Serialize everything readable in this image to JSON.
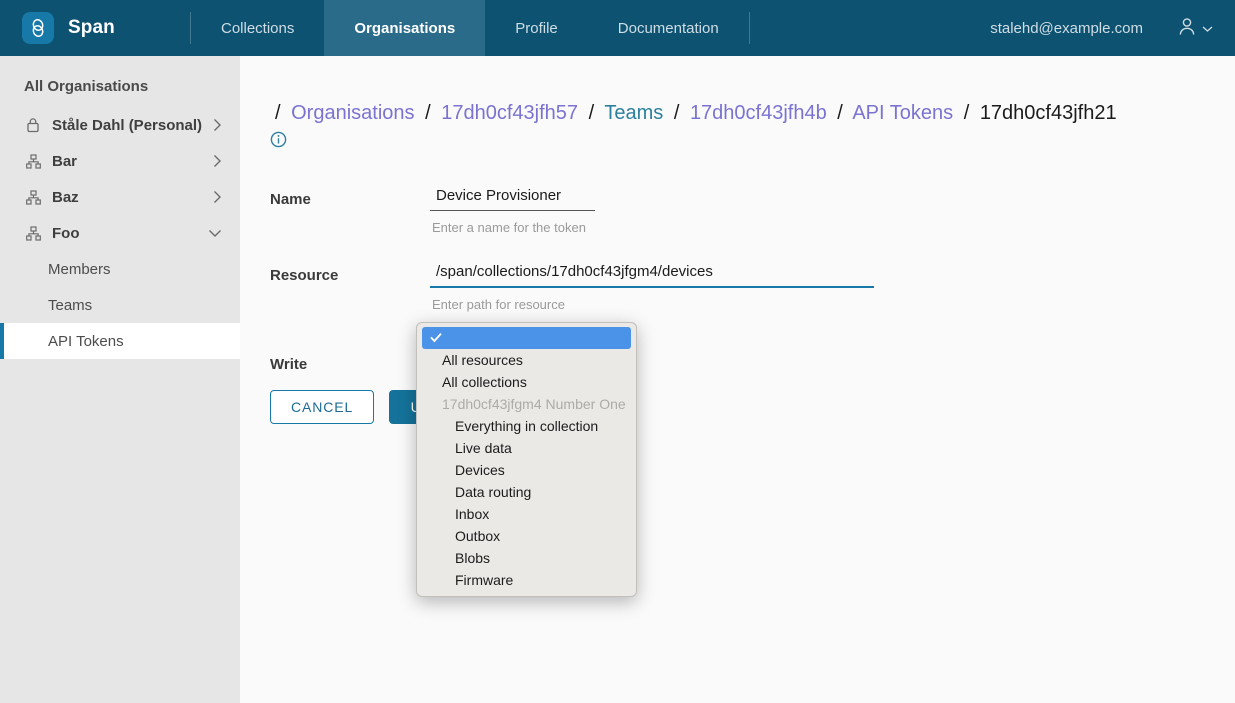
{
  "navbar": {
    "brand_name": "Span",
    "brand_icon": "span-logo-link-icon",
    "links": [
      {
        "label": "Collections",
        "active": false
      },
      {
        "label": "Organisations",
        "active": true
      },
      {
        "label": "Profile",
        "active": false
      },
      {
        "label": "Documentation",
        "active": false
      }
    ],
    "user_email": "stalehd@example.com",
    "avatar_icon": "user-avatar-icon",
    "avatar_chevron_icon": "chevron-down-icon"
  },
  "sidebar": {
    "title": "All Organisations",
    "items": [
      {
        "label": "Ståle Dahl (Personal)",
        "icon": "lock-icon",
        "chevron": "chevron-right-icon"
      },
      {
        "label": "Bar",
        "icon": "org-hierarchy-icon",
        "chevron": "chevron-right-icon"
      },
      {
        "label": "Baz",
        "icon": "org-hierarchy-icon",
        "chevron": "chevron-right-icon"
      },
      {
        "label": "Foo",
        "icon": "org-hierarchy-icon",
        "chevron": "chevron-down-icon"
      }
    ],
    "sub_items": [
      {
        "label": "Members",
        "active": false
      },
      {
        "label": "Teams",
        "active": false
      },
      {
        "label": "API Tokens",
        "active": true
      }
    ]
  },
  "breadcrumb": {
    "separator": "/",
    "segments": [
      {
        "label": "Organisations",
        "state": "visited"
      },
      {
        "label": "17dh0cf43jfh57",
        "state": "visited"
      },
      {
        "label": "Teams",
        "state": "unvisited"
      },
      {
        "label": "17dh0cf43jfh4b",
        "state": "visited"
      },
      {
        "label": "API Tokens",
        "state": "visited"
      },
      {
        "label": "17dh0cf43jfh21",
        "state": "current"
      }
    ],
    "info_icon": "info-circle-icon"
  },
  "form": {
    "name": {
      "label": "Name",
      "value": "Device Provisioner",
      "placeholder": "Enter a name for the token",
      "help": "Enter a name for the token"
    },
    "resource": {
      "label": "Resource",
      "value": "/span/collections/17dh0cf43jfgm4/devices",
      "placeholder": "Enter path for resource",
      "help": "Enter path for resource"
    },
    "write": {
      "label": "Write"
    },
    "buttons": {
      "cancel": "CANCEL",
      "update": "UPDATE"
    }
  },
  "dropdown": {
    "options": [
      {
        "label": "",
        "selected": true,
        "group": false,
        "indent": false,
        "check_icon": "checkmark-icon"
      },
      {
        "label": "All resources",
        "selected": false,
        "group": false,
        "indent": false
      },
      {
        "label": "All collections",
        "selected": false,
        "group": false,
        "indent": false
      },
      {
        "label": "17dh0cf43jfgm4 Number One",
        "selected": false,
        "group": true,
        "indent": false
      },
      {
        "label": "Everything in collection",
        "selected": false,
        "group": false,
        "indent": true
      },
      {
        "label": "Live data",
        "selected": false,
        "group": false,
        "indent": true
      },
      {
        "label": "Devices",
        "selected": false,
        "group": false,
        "indent": true
      },
      {
        "label": "Data routing",
        "selected": false,
        "group": false,
        "indent": true
      },
      {
        "label": "Inbox",
        "selected": false,
        "group": false,
        "indent": true
      },
      {
        "label": "Outbox",
        "selected": false,
        "group": false,
        "indent": true
      },
      {
        "label": "Blobs",
        "selected": false,
        "group": false,
        "indent": true
      },
      {
        "label": "Firmware",
        "selected": false,
        "group": false,
        "indent": true
      }
    ]
  },
  "colors": {
    "navbar_bg": "#0d5271",
    "navbar_active_tab": "#2a6b8a",
    "brand_mark": "#1779a8",
    "sidebar_bg": "#e6e6e6",
    "accent_teal": "#1779a8",
    "link_visited": "#7a73d1",
    "link_unvisited": "#2d7f9e",
    "dropdown_bg": "#ebe9e6",
    "dropdown_selected": "#4a93e8",
    "button_primary": "#15739b",
    "main_bg": "#fafafa"
  }
}
